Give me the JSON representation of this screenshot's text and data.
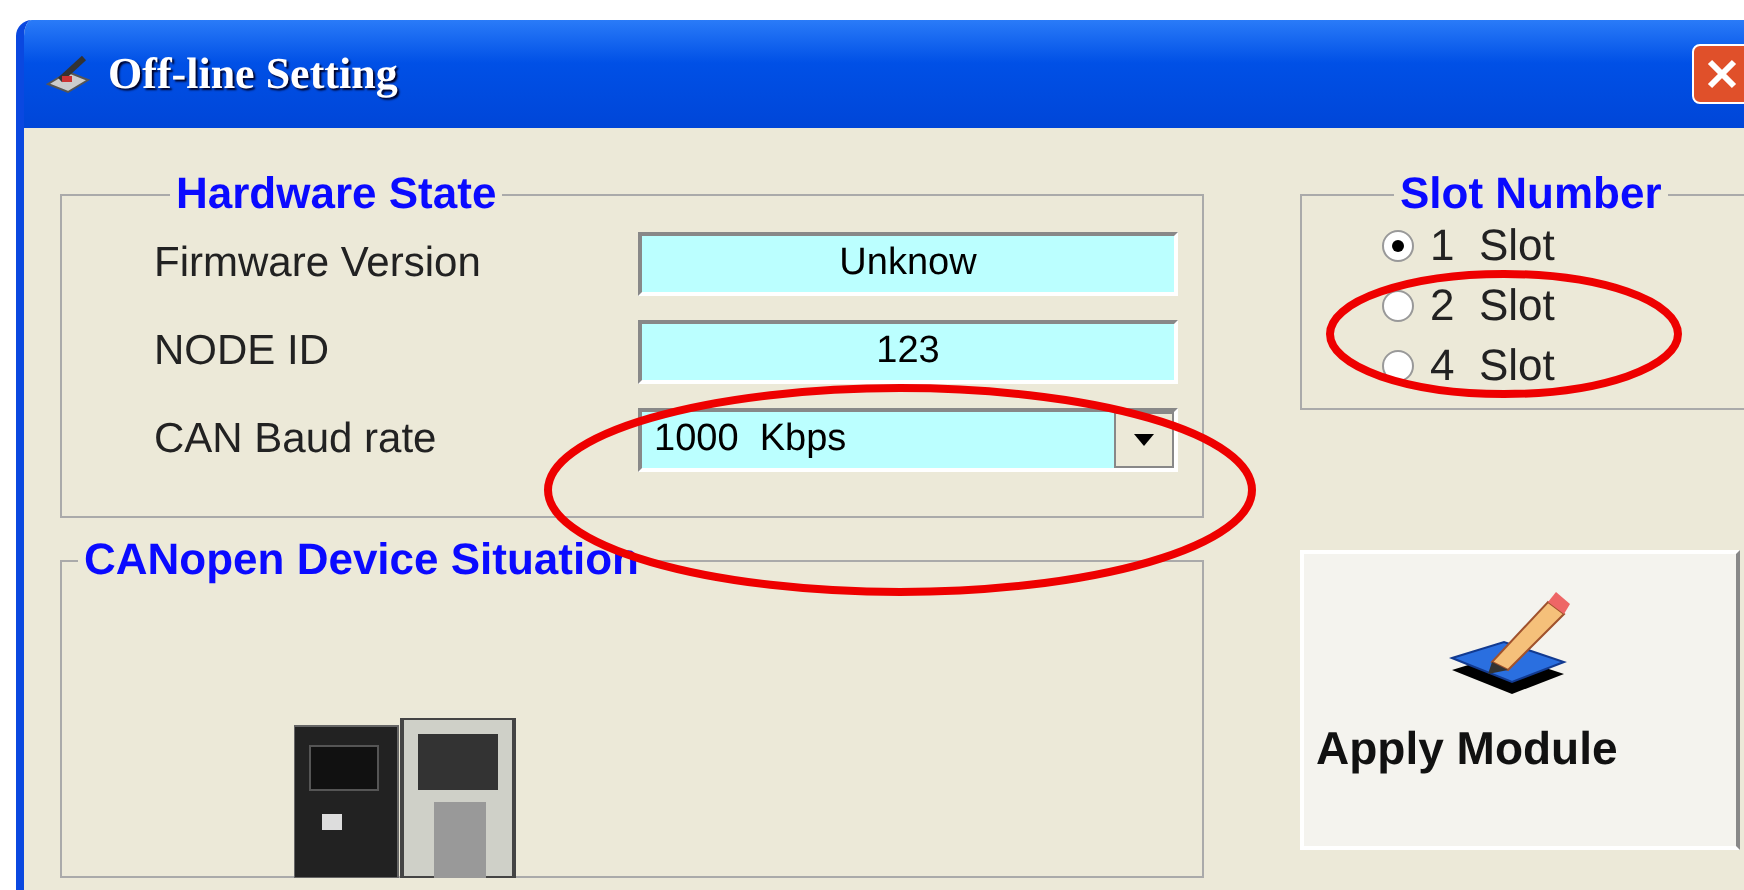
{
  "window": {
    "title": "Off-line Setting"
  },
  "hardware_state": {
    "title": "Hardware State",
    "fields": [
      {
        "label": "Firmware Version",
        "value": "Unknow",
        "kind": "text"
      },
      {
        "label": "NODE ID",
        "value": "123",
        "kind": "text"
      },
      {
        "label": "CAN Baud rate",
        "value": "1000  Kbps",
        "kind": "dropdown"
      }
    ]
  },
  "slot_number": {
    "title": "Slot Number",
    "options": [
      {
        "label": "1  Slot",
        "selected": true
      },
      {
        "label": "2  Slot",
        "selected": false
      },
      {
        "label": "4  Slot",
        "selected": false
      }
    ]
  },
  "device_situation": {
    "title": "CANopen Device Situation"
  },
  "apply_button": {
    "label": "Apply Module"
  }
}
